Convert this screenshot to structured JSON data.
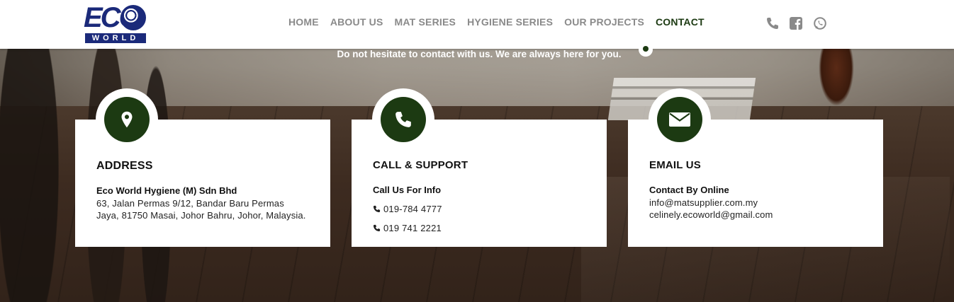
{
  "brand": {
    "logo_top": "ECO",
    "logo_bottom": "WORLD",
    "colors": {
      "logo_blue": "#1b2a7a",
      "accent_green": "#1c3a12",
      "nav_gray": "#8a8a8a"
    }
  },
  "nav": {
    "items": [
      {
        "label": "HOME",
        "active": false
      },
      {
        "label": "ABOUT US",
        "active": false
      },
      {
        "label": "MAT SERIES",
        "active": false
      },
      {
        "label": "HYGIENE SERIES",
        "active": false
      },
      {
        "label": "OUR PROJECTS",
        "active": false
      },
      {
        "label": "CONTACT",
        "active": true
      }
    ]
  },
  "header_icons": [
    "phone-icon",
    "facebook-icon",
    "whatsapp-icon"
  ],
  "tagline": "Do not hesitate to contact with us. We are always here for you.",
  "cards": [
    {
      "icon": "map-marker-icon",
      "title": "ADDRESS",
      "subtitle": "Eco World Hygiene (M) Sdn Bhd",
      "text": "63, Jalan Permas 9/12, Bandar Baru Permas Jaya, 81750 Masai, Johor Bahru, Johor, Malaysia."
    },
    {
      "icon": "phone-icon",
      "title": "CALL & SUPPORT",
      "subtitle": "Call Us For Info",
      "phones": [
        "019-784 4777",
        "019 741 2221"
      ]
    },
    {
      "icon": "envelope-icon",
      "title": "EMAIL US",
      "subtitle": "Contact By Online",
      "text": "info@matsupplier.com.my celinely.ecoworld@gmail.com"
    }
  ]
}
